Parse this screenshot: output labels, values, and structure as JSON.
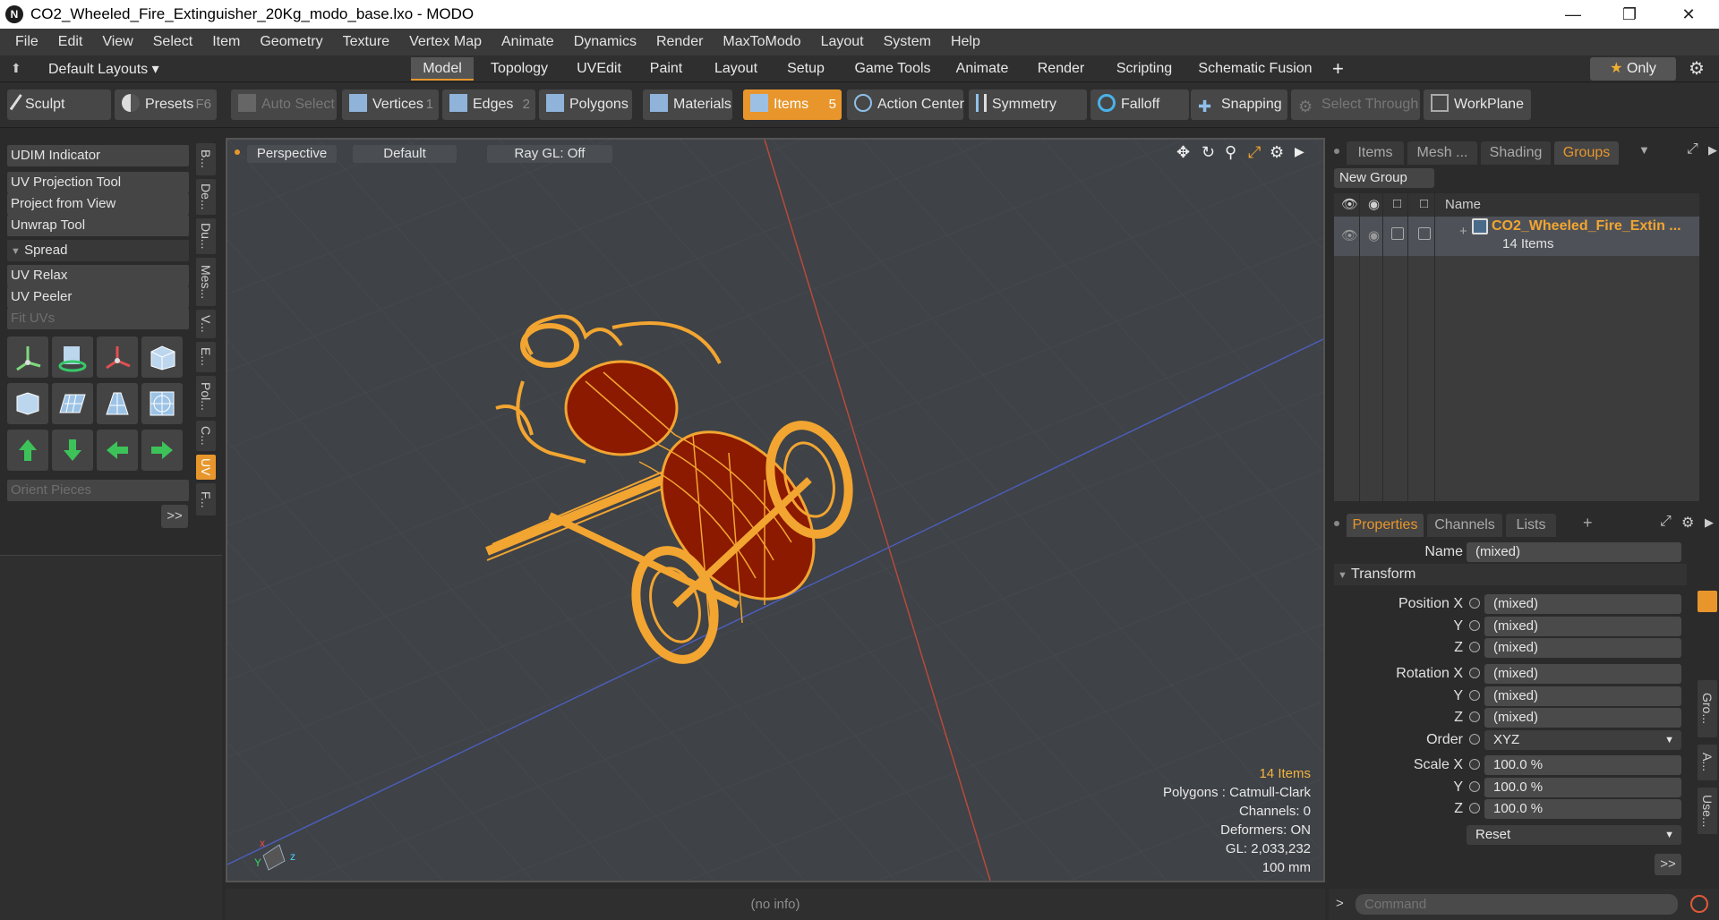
{
  "window": {
    "title": "CO2_Wheeled_Fire_Extinguisher_20Kg_modo_base.lxo - MODO",
    "logo": "N"
  },
  "menu": [
    "File",
    "Edit",
    "View",
    "Select",
    "Item",
    "Geometry",
    "Texture",
    "Vertex Map",
    "Animate",
    "Dynamics",
    "Render",
    "MaxToModo",
    "Layout",
    "System",
    "Help"
  ],
  "layoutbar": {
    "layout_label": "Default Layouts",
    "tabs": [
      "Model",
      "Topology",
      "UVEdit",
      "Paint",
      "Layout",
      "Setup",
      "Game Tools",
      "Animate",
      "Render",
      "Scripting",
      "Schematic Fusion"
    ],
    "active_tab": "Model",
    "only_label": "Only"
  },
  "toolbar": {
    "sculpt": "Sculpt",
    "presets": "Presets",
    "presets_key": "F6",
    "auto_select": "Auto Select",
    "vertices": "Vertices",
    "vertices_key": "1",
    "edges": "Edges",
    "edges_key": "2",
    "polygons": "Polygons",
    "materials": "Materials",
    "items": "Items",
    "items_key": "5",
    "action_center": "Action Center",
    "symmetry": "Symmetry",
    "falloff": "Falloff",
    "snapping": "Snapping",
    "select_through": "Select Through",
    "workplane": "WorkPlane"
  },
  "leftpanel": {
    "buttons": [
      "UDIM Indicator",
      "UV Projection Tool",
      "Project from View",
      "Unwrap Tool"
    ],
    "spread": "Spread",
    "buttons2": [
      "UV Relax",
      "UV Peeler",
      "Fit UVs"
    ],
    "orient": "Orient Pieces",
    "more": ">>",
    "vtabs": [
      "B...",
      "De...",
      "Du...",
      "Mes...",
      "V...",
      "E...",
      "Pol...",
      "C...",
      "UV",
      "F..."
    ]
  },
  "viewport": {
    "view": "Perspective",
    "shading": "Default",
    "raygl": "Ray GL: Off",
    "info": {
      "items": "14 Items",
      "polygons": "Polygons : Catmull-Clark",
      "channels": "Channels: 0",
      "deformers": "Deformers: ON",
      "gl": "GL: 2,033,232",
      "scale": "100 mm"
    },
    "colors": {
      "wire": "#f2a531",
      "body": "#8b1a00",
      "bg": "#3f4246"
    }
  },
  "status": "(no info)",
  "rtop": {
    "tabs": [
      "Items",
      "Mesh ...",
      "Shading",
      "Groups"
    ],
    "active_tab": "Groups",
    "new_group": "New Group",
    "col_name": "Name",
    "group_name": "CO2_Wheeled_Fire_Extin ...",
    "group_count": "14 Items"
  },
  "properties": {
    "tabs": [
      "Properties",
      "Channels",
      "Lists"
    ],
    "name_label": "Name",
    "name_value": "(mixed)",
    "transform": "Transform",
    "rows": [
      {
        "label": "Position X",
        "value": "(mixed)"
      },
      {
        "label": "Y",
        "value": "(mixed)"
      },
      {
        "label": "Z",
        "value": "(mixed)"
      },
      {
        "label": "Rotation X",
        "value": "(mixed)"
      },
      {
        "label": "Y",
        "value": "(mixed)"
      },
      {
        "label": "Z",
        "value": "(mixed)"
      },
      {
        "label": "Order",
        "value": "XYZ"
      },
      {
        "label": "Scale X",
        "value": "100.0 %"
      },
      {
        "label": "Y",
        "value": "100.0 %"
      },
      {
        "label": "Z",
        "value": "100.0 %"
      }
    ],
    "reset": "Reset",
    "more": ">>",
    "side_tabs": [
      "Gro...",
      "A...",
      "Use..."
    ]
  },
  "command": {
    "prompt": ">",
    "placeholder": "Command"
  }
}
